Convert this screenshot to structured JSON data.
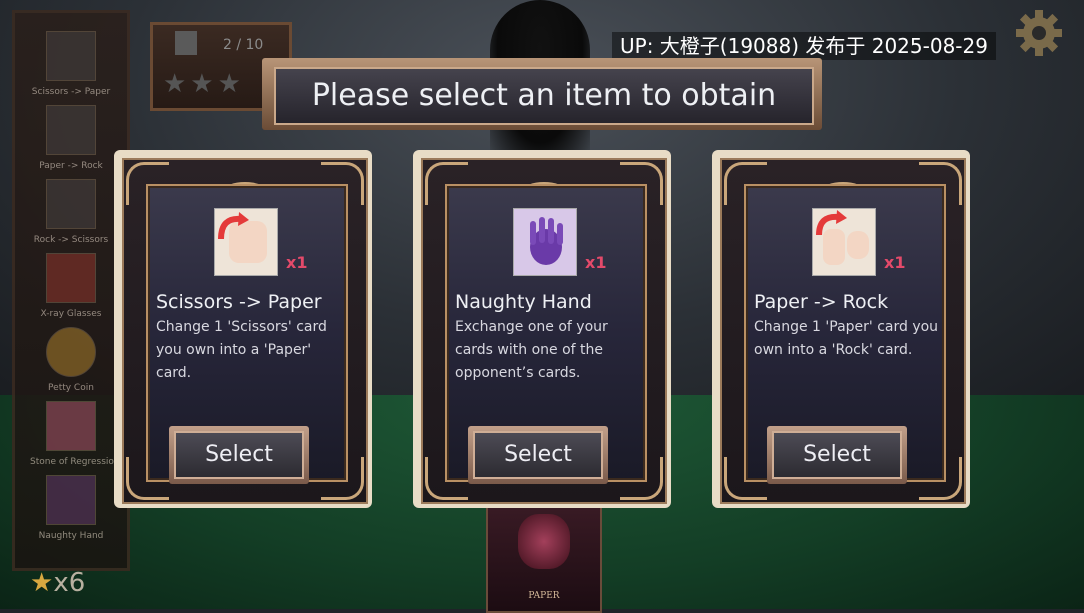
{
  "watermark": "UP: 大橙子(19088) 发布于 2025-08-29",
  "header": {
    "title": "Please select an item to obtain"
  },
  "score_box": {
    "progress_text": "2 / 10",
    "stars_filled": 0,
    "stars_total": 3
  },
  "sidebar": {
    "items": [
      {
        "label": "Scissors -> Paper",
        "icon": "scissors-to-paper-icon"
      },
      {
        "label": "Paper -> Rock",
        "icon": "paper-to-rock-icon"
      },
      {
        "label": "Rock -> Scissors",
        "icon": "rock-to-scissors-icon"
      },
      {
        "label": "X-ray Glasses",
        "icon": "xray-glasses-icon"
      },
      {
        "label": "Petty Coin",
        "icon": "coin-icon"
      },
      {
        "label": "Stone of Regression",
        "icon": "stone-icon"
      },
      {
        "label": "Naughty Hand",
        "icon": "naughty-hand-icon"
      }
    ],
    "star_count": "x6"
  },
  "cards": [
    {
      "name": "Scissors -> Paper",
      "quantity": "x1",
      "description": "Change 1 'Scissors' card you own into a 'Paper' card.",
      "button": "Select",
      "icon": "scissors-to-paper-icon"
    },
    {
      "name": "Naughty Hand",
      "quantity": "x1",
      "description": "Exchange one of your cards with one of the opponent’s cards.",
      "button": "Select",
      "icon": "naughty-hand-icon"
    },
    {
      "name": "Paper -> Rock",
      "quantity": "x1",
      "description": "Change 1 'Paper' card you own into a 'Rock' card.",
      "button": "Select",
      "icon": "paper-to-rock-icon"
    }
  ],
  "table_card": {
    "label": "PAPER"
  },
  "colors": {
    "accent_gold": "#c9a67a",
    "qty_red": "#e44a6a"
  }
}
